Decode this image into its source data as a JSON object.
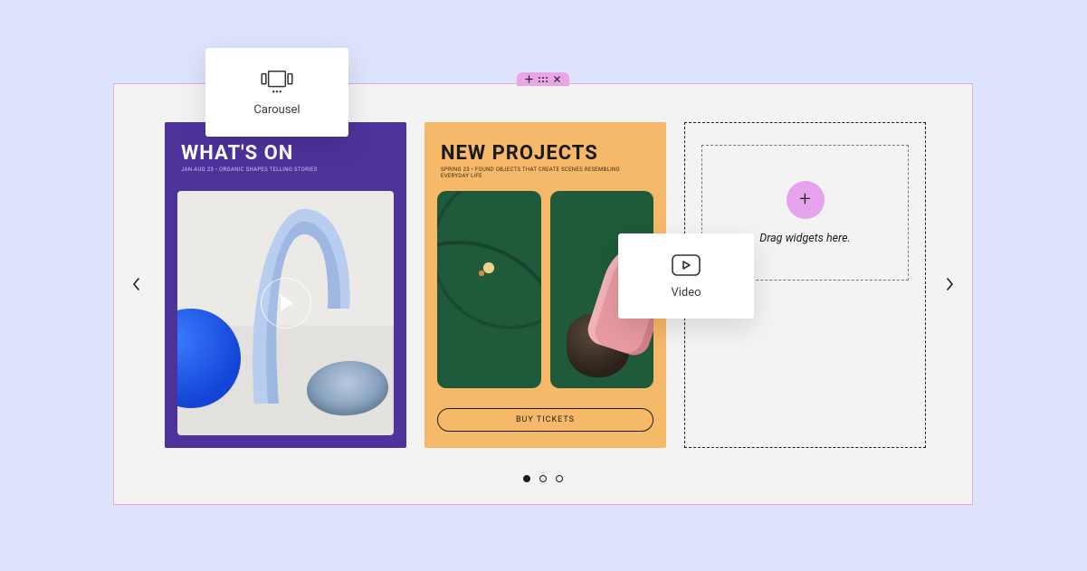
{
  "section_handle": {
    "add_label": "+",
    "drag_label": "⋮⋮⋮",
    "close_label": "×"
  },
  "carousel": {
    "pagination": {
      "count": 3,
      "active_index": 0
    },
    "slides": [
      {
        "title": "WHAT'S ON",
        "subtitle": "JAN-AUG 23 • ORGANIC SHAPES TELLING STORIES"
      },
      {
        "title": "NEW PROJECTS",
        "subtitle": "SPRING 23 • FOUND OBJECTS THAT CREATE SCENES RESEMBLING EVERYDAY LIFE",
        "cta_label": "BUY TICKETS"
      }
    ],
    "drop_slot": {
      "hint": "Drag widgets here.",
      "add_icon": "+"
    }
  },
  "widgets": {
    "carousel_card": {
      "label": "Carousel"
    },
    "video_card": {
      "label": "Video"
    }
  }
}
